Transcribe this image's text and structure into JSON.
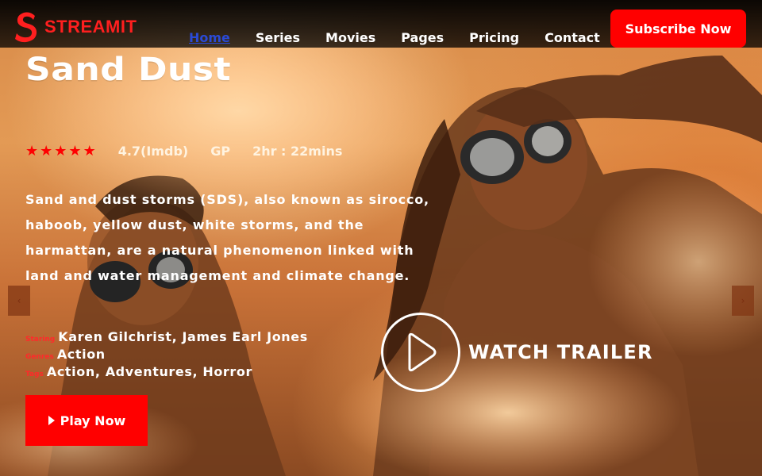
{
  "brand": {
    "name": "STREAMIT",
    "accent": "#ff0000"
  },
  "nav": {
    "items": [
      {
        "label": "Home",
        "active": true
      },
      {
        "label": "Series"
      },
      {
        "label": "Movies"
      },
      {
        "label": "Pages"
      },
      {
        "label": "Pricing"
      },
      {
        "label": "Contact"
      }
    ],
    "subscribe_label": "Subscribe Now"
  },
  "hero": {
    "title": "Sand Dust",
    "rating_stars": 5,
    "rating": "4.7(Imdb)",
    "certificate": "GP",
    "duration": "2hr : 22mins",
    "description": "Sand and dust storms (SDS), also known as sirocco, haboob, yellow dust, white storms, and the harmattan, are a natural phenomenon linked with land and water management and climate change.",
    "staring_label": "Staring",
    "staring_value": "Karen Gilchrist, James Earl Jones",
    "genres_label": "Genres",
    "genres_value": "Action",
    "tags_label": "Tags",
    "tags_value": "Action, Adventures, Horror",
    "play_label": "Play Now",
    "play_icon": "play-icon",
    "trailer_label": "WATCH TRAILER",
    "trailer_icon": "play-circle-icon"
  },
  "carousel": {
    "prev_icon": "chevron-left-icon",
    "next_icon": "chevron-right-icon"
  }
}
